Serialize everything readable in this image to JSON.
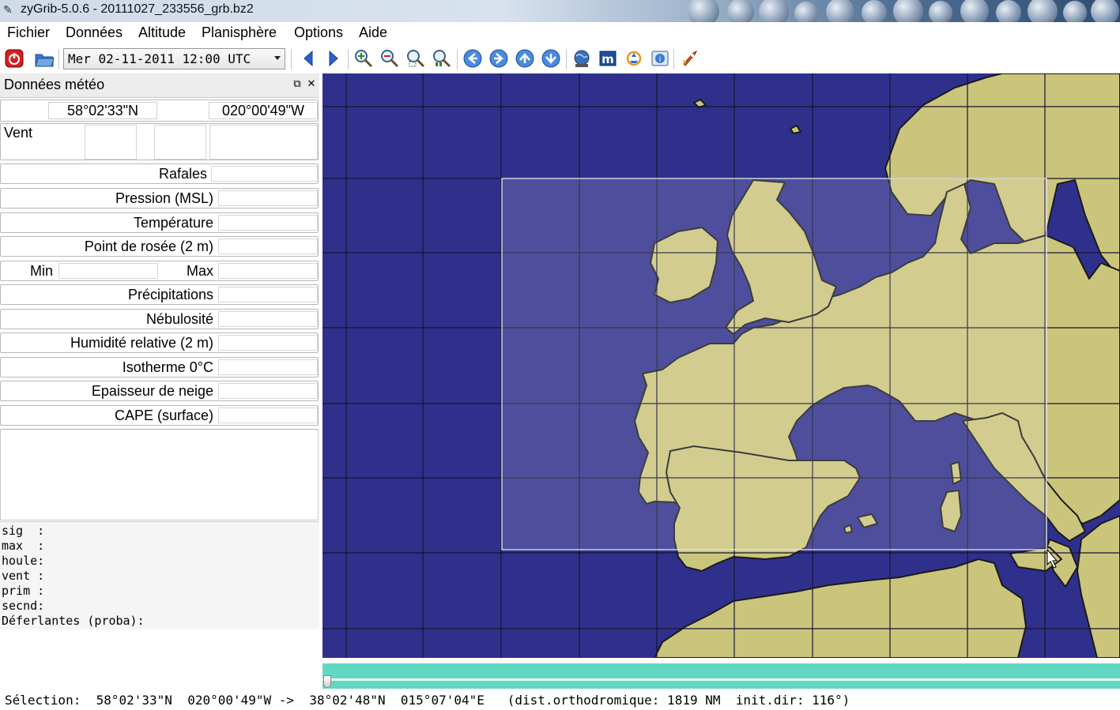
{
  "window": {
    "title": "zyGrib-5.0.6 - 20111027_233556_grb.bz2"
  },
  "menu": [
    "Fichier",
    "Données",
    "Altitude",
    "Planisphère",
    "Options",
    "Aide"
  ],
  "toolbar": {
    "date_value": "Mer 02-11-2011 12:00 UTC",
    "icons": [
      "quit-icon",
      "open-file-icon",
      "previous-date-icon",
      "next-date-icon",
      "zoom-in-icon",
      "zoom-out-icon",
      "zoom-selection-icon",
      "zoom-all-icon",
      "pan-left-icon",
      "pan-right-icon",
      "pan-up-icon",
      "pan-down-icon",
      "globe-download-icon",
      "metar-icon",
      "boat-icon",
      "grib-server-icon",
      "rocket-icon"
    ]
  },
  "panel": {
    "title": "Données météo",
    "latitude": "58°02'33\"N",
    "longitude": "020°00'49\"W",
    "wind_label": "Vent",
    "gusts_label": "Rafales",
    "pressure_label": "Pression (MSL)",
    "temperature_label": "Température",
    "dewpoint_label": "Point de rosée (2 m)",
    "min_label": "Min",
    "max_label": "Max",
    "precip_label": "Précipitations",
    "cloud_label": "Nébulosité",
    "humidity_label": "Humidité relative (2 m)",
    "isotherm_label": "Isotherme 0°C",
    "snow_label": "Epaisseur de neige",
    "cape_label": "CAPE (surface)",
    "waves_text": "sig  :\nmax  :\nhoule:\nvent :\nprim :\nsecnd:\nDéferlantes (proba):"
  },
  "status": {
    "text": "Sélection:  58°02'33\"N  020°00'49\"W ->  38°02'48\"N  015°07'04\"E   (dist.orthodromique: 1819 NM  init.dir: 116°)"
  },
  "colors": {
    "sea": "#2f308c",
    "land": "#cbc57c",
    "timeline": "#60d8c2"
  }
}
